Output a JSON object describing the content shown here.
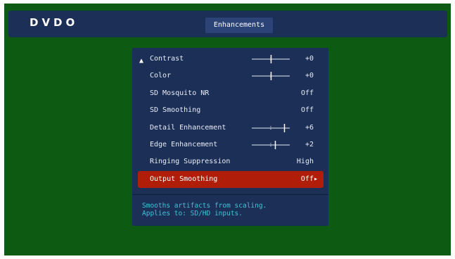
{
  "header": {
    "logo": "DVDO",
    "title": "Enhancements"
  },
  "menu": {
    "items": [
      {
        "label": "Contrast",
        "value": "+0",
        "slider": true,
        "level": 0.5,
        "up_arrow": true
      },
      {
        "label": "Color",
        "value": "+0",
        "slider": true,
        "level": 0.5
      },
      {
        "label": "SD Mosquito NR",
        "value": "Off"
      },
      {
        "label": "SD Smoothing",
        "value": "Off"
      },
      {
        "label": "Detail Enhancement",
        "value": "+6",
        "slider": true,
        "level": 0.85
      },
      {
        "label": "Edge Enhancement",
        "value": "+2",
        "slider": true,
        "level": 0.62
      },
      {
        "label": "Ringing Suppression",
        "value": "High"
      },
      {
        "label": "Output Smoothing",
        "value": "Off▸",
        "selected": true
      }
    ],
    "description": {
      "line1": "Smooths artifacts from scaling.",
      "line2": "Applies to: SD/HD inputs."
    }
  },
  "colors": {
    "background": "#0d5a12",
    "panel": "#1c2f57",
    "title_tab": "#2c4378",
    "selected": "#b01e0a",
    "description_text": "#3fc3d7"
  }
}
